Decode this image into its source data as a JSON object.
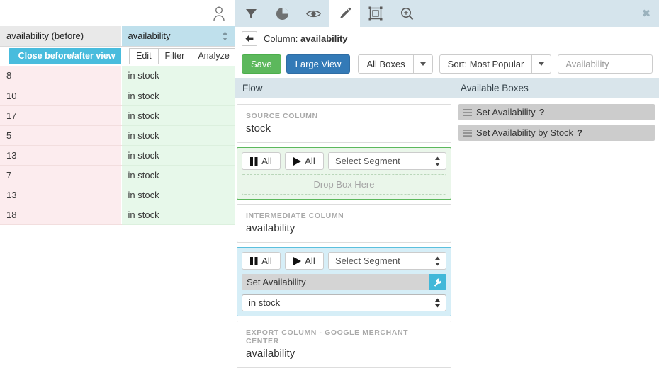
{
  "grid": {
    "user_icon": "user-icon",
    "columns": [
      {
        "header": "availability (before)",
        "key": "before"
      },
      {
        "header": "availability",
        "key": "after"
      }
    ],
    "close_view_button": "Close before/after view",
    "row_actions": [
      "Edit",
      "Filter",
      "Analyze"
    ],
    "rows": [
      {
        "before": "8",
        "after": "in stock"
      },
      {
        "before": "10",
        "after": "in stock"
      },
      {
        "before": "17",
        "after": "in stock"
      },
      {
        "before": "5",
        "after": "in stock"
      },
      {
        "before": "13",
        "after": "in stock"
      },
      {
        "before": "7",
        "after": "in stock"
      },
      {
        "before": "13",
        "after": "in stock"
      },
      {
        "before": "18",
        "after": "in stock"
      }
    ],
    "colors": {
      "before_cell_bg": "#fcecee",
      "after_cell_bg": "#e7f8ea",
      "before_header_bg": "#e9e9e9",
      "after_header_bg": "#bfe0ec",
      "close_button_bg": "#49bcdd"
    }
  },
  "panel": {
    "tabs": [
      {
        "icon": "filter-icon",
        "active": false
      },
      {
        "icon": "pie-chart-icon",
        "active": false
      },
      {
        "icon": "eye-icon",
        "active": false
      },
      {
        "icon": "pencil-icon",
        "active": true
      },
      {
        "icon": "select-frame-icon",
        "active": false
      },
      {
        "icon": "zoom-in-icon",
        "active": false
      }
    ],
    "close_label": "✖",
    "breadcrumb": {
      "back_icon": "arrow-left-icon",
      "prefix": "Column: ",
      "column_name": "availability"
    },
    "controls": {
      "save_label": "Save",
      "large_view_label": "Large View",
      "boxes_filter_label": "All Boxes",
      "sort_label": "Sort: Most Popular",
      "search_placeholder": "Availability",
      "search_value": ""
    },
    "section_headers": {
      "flow": "Flow",
      "available_boxes": "Available Boxes"
    },
    "flow": {
      "source": {
        "label": "Source Column",
        "value": "stock"
      },
      "source_stage": {
        "pause_all_label": "All",
        "play_all_label": "All",
        "segment_label": "Select Segment",
        "dropzone_label": "Drop Box Here"
      },
      "intermediate": {
        "label": "Intermediate Column",
        "value": "availability"
      },
      "intermediate_stage": {
        "pause_all_label": "All",
        "play_all_label": "All",
        "segment_label": "Select Segment",
        "box_name": "Set Availability",
        "box_wrench_icon": "wrench-icon",
        "box_value": "in stock"
      },
      "export": {
        "label": "Export Column - Google Merchant Center",
        "value": "availability"
      }
    },
    "available_boxes": [
      {
        "name": "Set Availability",
        "help": "?"
      },
      {
        "name": "Set Availability by Stock",
        "help": "?"
      }
    ],
    "colors": {
      "tabbar_bg": "#d5e4ec",
      "section_header_bg": "#d9e5eb",
      "save_green": "#5cb85c",
      "large_view_blue": "#337ab7",
      "wrench_blue": "#42b8d9",
      "source_stage_border": "#5cb85c",
      "intermediate_stage_border": "#5bc0de"
    }
  }
}
